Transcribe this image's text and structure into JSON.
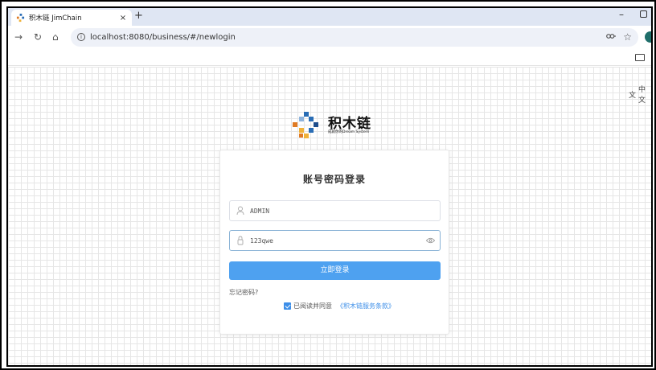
{
  "browser": {
    "tab": {
      "title": "积木链 JimChain",
      "close": "×"
    },
    "new_tab": "+",
    "window_min": "–",
    "url": "localhost:8080/business/#/newlogin",
    "info_icon": "i",
    "translate_label": "中文"
  },
  "logo": {
    "name": "积木链",
    "tagline": "成就你的Dream System",
    "colors": [
      "#2a6db5",
      "#e07b24",
      "#f0b23a",
      "#1e4d8c"
    ]
  },
  "login": {
    "title": "账号密码登录",
    "username": {
      "value": "ADMIN",
      "placeholder": ""
    },
    "password": {
      "value": "123qwe",
      "placeholder": ""
    },
    "submit_label": "立即登录",
    "forgot_label": "忘记密码?",
    "agree_checked": true,
    "agree_label": "已阅读并同意",
    "terms_label": "《积木链服务条款》"
  },
  "colors": {
    "primary": "#4ea1f0",
    "link": "#3c8ee8",
    "tabstrip": "#dfe6f3"
  }
}
